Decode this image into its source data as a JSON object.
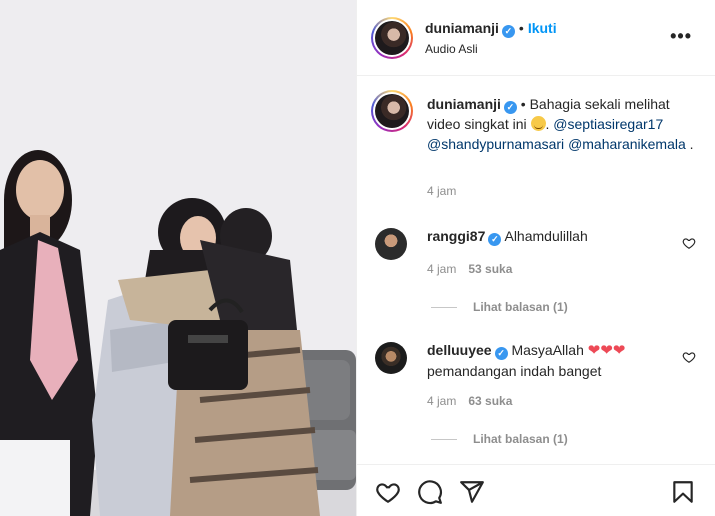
{
  "post": {
    "username": "duniamanji",
    "follow_label": "Ikuti",
    "audio_label": "Audio Asli",
    "more_label": "•••"
  },
  "caption": {
    "username": "duniamanji",
    "bullet": "•",
    "text_before": "Bahagia sekali melihat video singkat ini",
    "mention1": "@septiasiregar17",
    "mention2": "@shandypurnamasari",
    "mention3": "@maharanikemala",
    "text_after": ".",
    "time": "4 jam"
  },
  "comments": [
    {
      "username": "ranggi87",
      "text": "Alhamdulillah",
      "time": "4 jam",
      "likes": "53 suka",
      "replies": "Lihat balasan (1)"
    },
    {
      "username": "delluuyee",
      "text": "MasyaAllah",
      "hearts": "❤❤❤",
      "text_line2": "pemandangan indah banget",
      "time": "4 jam",
      "likes": "63 suka",
      "replies": "Lihat balasan (1)"
    }
  ],
  "icons": {
    "like": "heart-icon",
    "comment": "comment-icon",
    "share": "send-icon",
    "save": "bookmark-icon",
    "verified": "verified-badge-icon"
  },
  "colors": {
    "link": "#0095f6",
    "mention": "#00376b",
    "muted": "#8e8e8e",
    "heart": "#ed4956"
  }
}
